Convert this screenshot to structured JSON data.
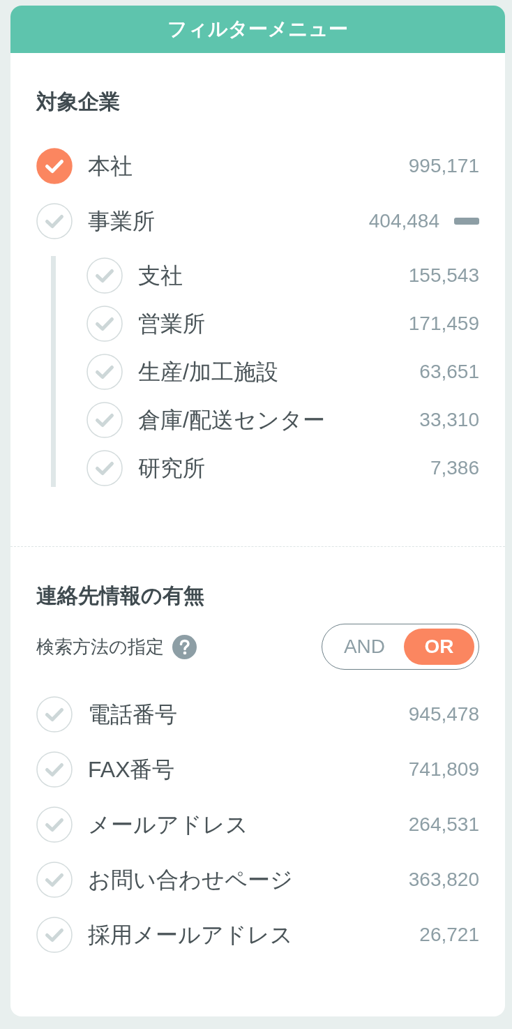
{
  "panel": {
    "title": "フィルターメニュー"
  },
  "sections": [
    {
      "title": "対象企業",
      "items": [
        {
          "label": "本社",
          "count": "995,171",
          "checked": true
        },
        {
          "label": "事業所",
          "count": "404,484",
          "checked": false,
          "expanded": true,
          "children": [
            {
              "label": "支社",
              "count": "155,543",
              "checked": false
            },
            {
              "label": "営業所",
              "count": "171,459",
              "checked": false
            },
            {
              "label": "生産/加工施設",
              "count": "63,651",
              "checked": false
            },
            {
              "label": "倉庫/配送センター",
              "count": "33,310",
              "checked": false
            },
            {
              "label": "研究所",
              "count": "7,386",
              "checked": false
            }
          ]
        }
      ]
    },
    {
      "title": "連絡先情報の有無",
      "match_mode": {
        "label": "検索方法の指定",
        "options": [
          {
            "label": "AND",
            "selected": false
          },
          {
            "label": "OR",
            "selected": true
          }
        ]
      },
      "items": [
        {
          "label": "電話番号",
          "count": "945,478",
          "checked": false
        },
        {
          "label": "FAX番号",
          "count": "741,809",
          "checked": false
        },
        {
          "label": "メールアドレス",
          "count": "264,531",
          "checked": false
        },
        {
          "label": "お問い合わせページ",
          "count": "363,820",
          "checked": false
        },
        {
          "label": "採用メールアドレス",
          "count": "26,721",
          "checked": false
        }
      ]
    }
  ]
}
